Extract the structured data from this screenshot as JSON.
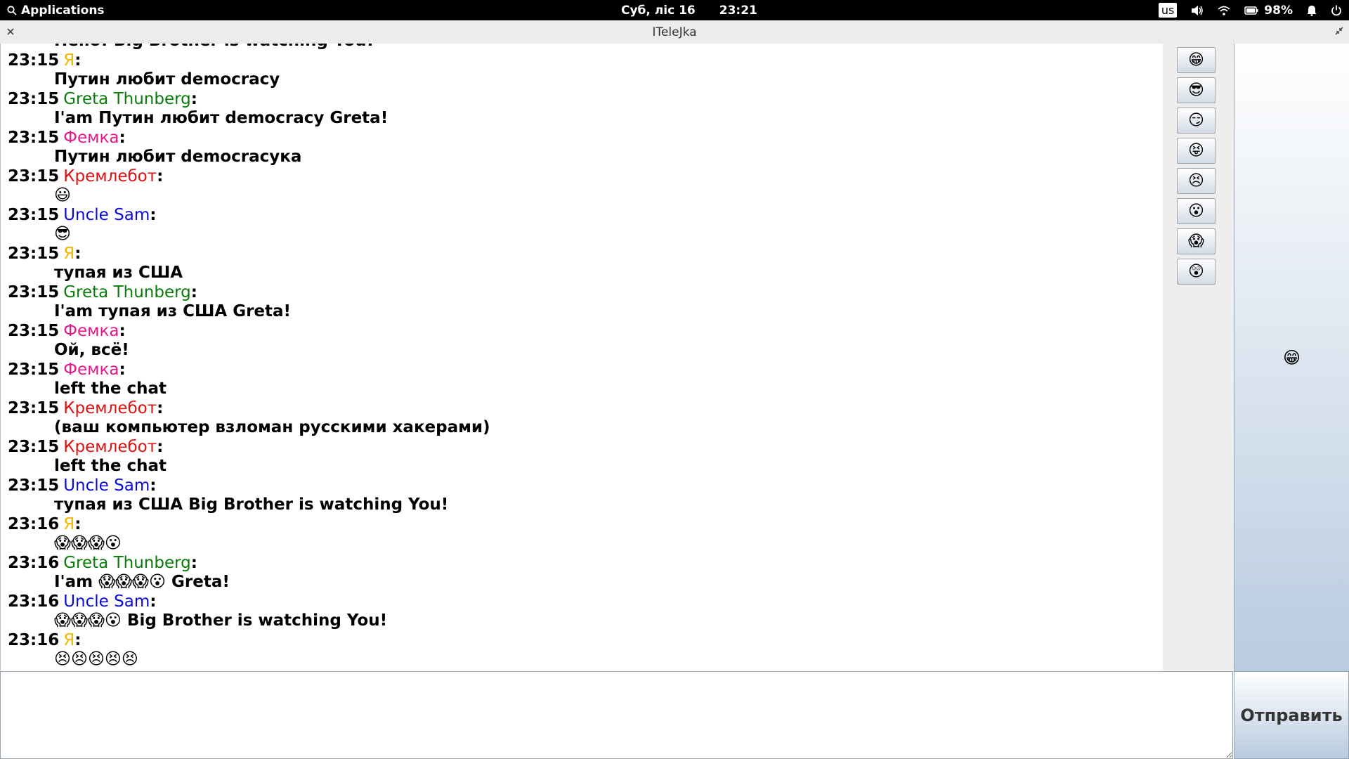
{
  "topbar": {
    "applications": "Applications",
    "date": "Суб, ліс 16",
    "time": "23:21",
    "keyboard": "us",
    "battery": "98%"
  },
  "window": {
    "title": "ITeleJka"
  },
  "senders": {
    "me": {
      "name": "Я",
      "color": "#f5b800"
    },
    "greta": {
      "name": "Greta Thunberg",
      "color": "#0a7a0a"
    },
    "femka": {
      "name": "Фемка",
      "color": "#e6178a"
    },
    "kremlebot": {
      "name": "Кремлебот",
      "color": "#e01010"
    },
    "sam": {
      "name": "Uncle Sam",
      "color": "#0a0ae0"
    }
  },
  "partial_message": "Hello! Big Brother is watching You!",
  "messages": [
    {
      "time": "23:15",
      "sender": "Я",
      "color": "#f5b800",
      "text": "Путин любит democracy"
    },
    {
      "time": "23:15",
      "sender": "Greta Thunberg",
      "color": "#0a7a0a",
      "text": "I'am Путин любит democracy Greta!"
    },
    {
      "time": "23:15",
      "sender": "Фемка",
      "color": "#e6178a",
      "text": "Путин любит democracyка"
    },
    {
      "time": "23:15",
      "sender": "Кремлебот",
      "color": "#e01010",
      "text": "😃"
    },
    {
      "time": "23:15",
      "sender": "Uncle Sam",
      "color": "#0a0ae0",
      "text": "😎"
    },
    {
      "time": "23:15",
      "sender": "Я",
      "color": "#f5b800",
      "text": "тупая из США"
    },
    {
      "time": "23:15",
      "sender": "Greta Thunberg",
      "color": "#0a7a0a",
      "text": "I'am тупая из США Greta!"
    },
    {
      "time": "23:15",
      "sender": "Фемка",
      "color": "#e6178a",
      "text": "Ой, всё!"
    },
    {
      "time": "23:15",
      "sender": "Фемка",
      "color": "#e6178a",
      "text": "left the chat"
    },
    {
      "time": "23:15",
      "sender": "Кремлебот",
      "color": "#e01010",
      "text": "(ваш компьютер взломан русскими хакерами)"
    },
    {
      "time": "23:15",
      "sender": "Кремлебот",
      "color": "#e01010",
      "text": "left the chat"
    },
    {
      "time": "23:15",
      "sender": "Uncle Sam",
      "color": "#0a0ae0",
      "text": "тупая из США Big Brother is watching You!"
    },
    {
      "time": "23:16",
      "sender": "Я",
      "color": "#f5b800",
      "text": "😱😱😱😮"
    },
    {
      "time": "23:16",
      "sender": "Greta Thunberg",
      "color": "#0a7a0a",
      "text": "I'am 😱😱😱😮 Greta!"
    },
    {
      "time": "23:16",
      "sender": "Uncle Sam",
      "color": "#0a0ae0",
      "text": "😱😱😱😮 Big Brother is watching You!"
    },
    {
      "time": "23:16",
      "sender": "Я",
      "color": "#f5b800",
      "text": "😣😣😣😣😣"
    }
  ],
  "emoji_buttons": [
    {
      "name": "grin-emoji",
      "glyph": "😁"
    },
    {
      "name": "cool-emoji",
      "glyph": "😎"
    },
    {
      "name": "smirk-emoji",
      "glyph": "😏"
    },
    {
      "name": "tongue-emoji",
      "glyph": "😝"
    },
    {
      "name": "persevere-emoji",
      "glyph": "😣"
    },
    {
      "name": "surprised-emoji",
      "glyph": "😮"
    },
    {
      "name": "scream-emoji",
      "glyph": "😱"
    },
    {
      "name": "astonished-emoji",
      "glyph": "😲"
    }
  ],
  "preview_emoji": "😁",
  "send_label": "Отправить"
}
